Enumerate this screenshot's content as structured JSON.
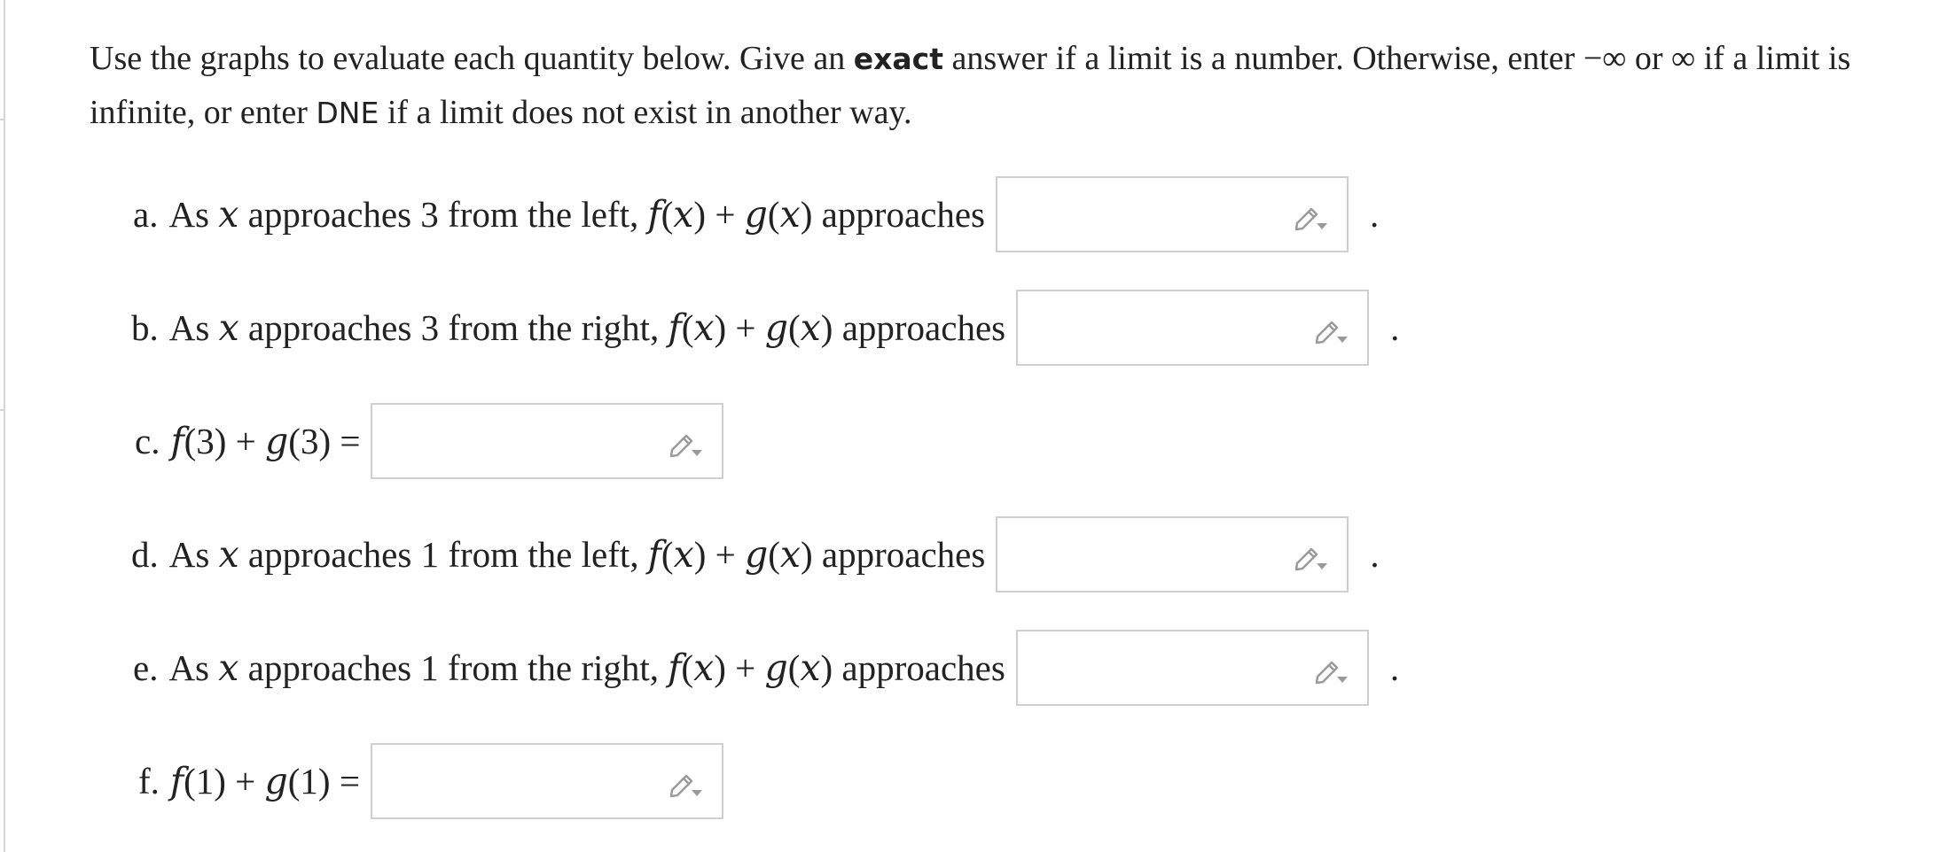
{
  "instructions": {
    "part1": "Use the graphs to evaluate each quantity below. Give an ",
    "exact": "exact",
    "part2": " answer if a limit is a number. Otherwise, enter ",
    "neg_inf": "−∞",
    "part3": " or ",
    "pos_inf": "∞",
    "part4": " if a limit is infinite, or enter ",
    "dne": "DNE",
    "part5": " if a limit does not exist in another way."
  },
  "questions": [
    {
      "label": "a.",
      "text": "As 𝑥 approaches 3 from the left, 𝑓(𝑥) + 𝑔(𝑥) approaches",
      "value": "",
      "trailing": "."
    },
    {
      "label": "b.",
      "text": "As 𝑥 approaches 3 from the right, 𝑓(𝑥) + 𝑔(𝑥) approaches",
      "value": "",
      "trailing": "."
    },
    {
      "label": "c.",
      "text": "𝑓(3) + 𝑔(3) =",
      "value": "",
      "trailing": ""
    },
    {
      "label": "d.",
      "text": "As 𝑥 approaches 1 from the left, 𝑓(𝑥) + 𝑔(𝑥) approaches",
      "value": "",
      "trailing": "."
    },
    {
      "label": "e.",
      "text": "As 𝑥 approaches 1 from the right, 𝑓(𝑥) + 𝑔(𝑥) approaches",
      "value": "",
      "trailing": "."
    },
    {
      "label": "f.",
      "text": "𝑓(1) + 𝑔(1) =",
      "value": "",
      "trailing": ""
    }
  ],
  "icons": {
    "answer_tool": "pencil-dropdown-icon"
  },
  "colors": {
    "text": "#222222",
    "box_border": "#cfcfcf",
    "icon": "#9a9a9a"
  }
}
